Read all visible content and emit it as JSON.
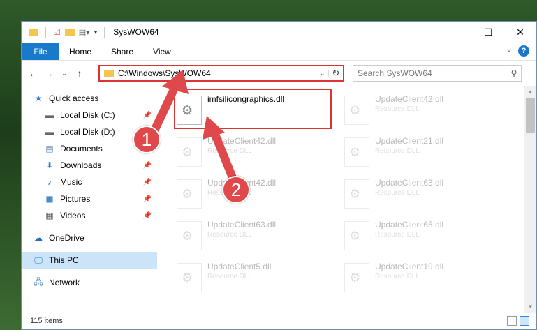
{
  "window": {
    "title": "SysWOW64"
  },
  "ribbon": {
    "tabs": [
      {
        "label": "File"
      },
      {
        "label": "Home"
      },
      {
        "label": "Share"
      },
      {
        "label": "View"
      }
    ]
  },
  "address": {
    "path": "C:\\Windows\\SysWOW64"
  },
  "search": {
    "placeholder": "Search SysWOW64"
  },
  "sidebar": {
    "items": [
      {
        "label": "Quick access"
      },
      {
        "label": "Local Disk (C:)"
      },
      {
        "label": "Local Disk (D:)"
      },
      {
        "label": "Documents"
      },
      {
        "label": "Downloads"
      },
      {
        "label": "Music"
      },
      {
        "label": "Pictures"
      },
      {
        "label": "Videos"
      },
      {
        "label": "OneDrive"
      },
      {
        "label": "This PC"
      },
      {
        "label": "Network"
      }
    ]
  },
  "files": [
    {
      "name": "imfsilicongraphics.dll",
      "type": ""
    },
    {
      "name": "UpdateClient42.dll",
      "type": "Resource DLL"
    },
    {
      "name": "UpdateClient42.dll",
      "type": "Resource DLL"
    },
    {
      "name": "UpdateClient21.dll",
      "type": "Resource DLL"
    },
    {
      "name": "UpdateClient42.dll",
      "type": "Resource DLL"
    },
    {
      "name": "UpdateClient63.dll",
      "type": "Resource DLL"
    },
    {
      "name": "UpdateClient63.dll",
      "type": "Resource DLL"
    },
    {
      "name": "UpdateClient65.dll",
      "type": "Resource DLL"
    },
    {
      "name": "UpdateClient5.dll",
      "type": "Resource DLL"
    },
    {
      "name": "UpdateClient19.dll",
      "type": "Resource DLL"
    }
  ],
  "status": {
    "items_count": "115 items"
  },
  "callouts": {
    "one": "1",
    "two": "2"
  },
  "colors": {
    "accent": "#1979ca",
    "highlight": "#e0494b"
  }
}
